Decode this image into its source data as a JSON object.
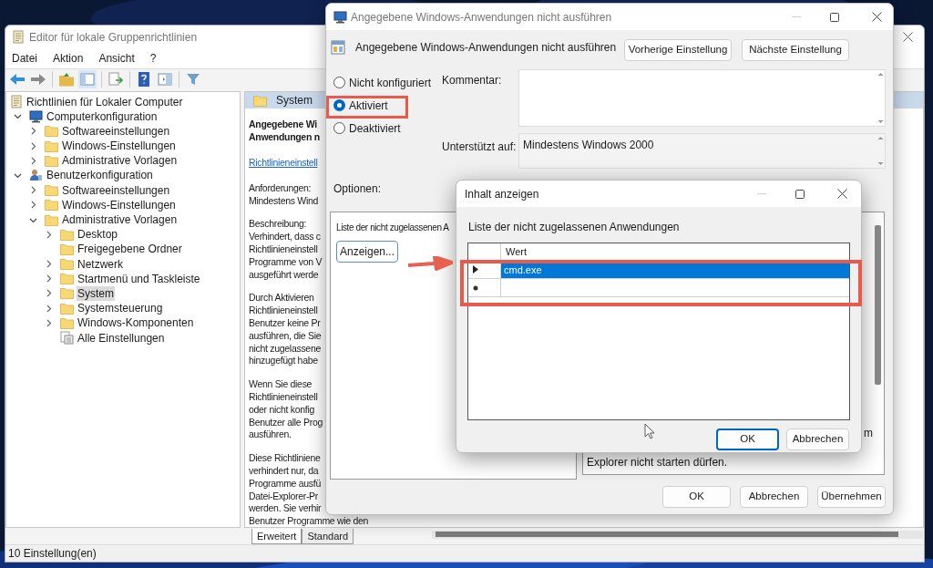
{
  "main_window": {
    "title": "Editor für lokale Gruppenrichtlinien",
    "menu": [
      "Datei",
      "Aktion",
      "Ansicht",
      "?"
    ],
    "tree": {
      "label": "Richtlinien für Lokaler Computer",
      "kind": "policy",
      "selected": false,
      "children": [
        {
          "label": "Computerkonfiguration",
          "kind": "computer",
          "expanded": true,
          "selected": false,
          "children": [
            {
              "label": "Softwareeinstellungen",
              "kind": "folder",
              "expanded": false,
              "selected": false
            },
            {
              "label": "Windows-Einstellungen",
              "kind": "folder",
              "expanded": false,
              "selected": false
            },
            {
              "label": "Administrative Vorlagen",
              "kind": "folder",
              "expanded": false,
              "selected": false
            }
          ]
        },
        {
          "label": "Benutzerkonfiguration",
          "kind": "user",
          "expanded": true,
          "selected": false,
          "children": [
            {
              "label": "Softwareeinstellungen",
              "kind": "folder",
              "expanded": false,
              "selected": false
            },
            {
              "label": "Windows-Einstellungen",
              "kind": "folder",
              "expanded": false,
              "selected": false
            },
            {
              "label": "Administrative Vorlagen",
              "kind": "folder",
              "expanded": true,
              "selected": false,
              "children": [
                {
                  "label": "Desktop",
                  "kind": "folder",
                  "expanded": false,
                  "selected": false
                },
                {
                  "label": "Freigegebene Ordner",
                  "kind": "folder",
                  "selected": false
                },
                {
                  "label": "Netzwerk",
                  "kind": "folder",
                  "expanded": false,
                  "selected": false
                },
                {
                  "label": "Startmenü und Taskleiste",
                  "kind": "folder",
                  "expanded": false,
                  "selected": false
                },
                {
                  "label": "System",
                  "kind": "folder",
                  "expanded": false,
                  "selected": true
                },
                {
                  "label": "Systemsteuerung",
                  "kind": "folder",
                  "expanded": false,
                  "selected": false
                },
                {
                  "label": "Windows-Komponenten",
                  "kind": "folder",
                  "expanded": false,
                  "selected": false
                },
                {
                  "label": "Alle Einstellungen",
                  "kind": "settings",
                  "selected": false
                }
              ]
            }
          ]
        }
      ]
    },
    "details": {
      "header": "System",
      "title_lines": [
        "Angegebene Wi",
        "Anwendungen n"
      ],
      "link": "Richtlinieneinstell",
      "paragraphs": [
        [
          "Anforderungen:",
          "Mindestens Wind"
        ],
        [
          "Beschreibung:",
          "Verhindert, dass c",
          "Richtlinieneinstell",
          "Programme von V",
          "ausgeführt werde"
        ],
        [
          "Durch Aktivieren",
          "Richtlinieneinstell",
          "Benutzer keine Pr",
          "ausführen, die Sie",
          "nicht zugelassene",
          "hinzugefügt habe"
        ],
        [
          "Wenn Sie diese",
          "Richtlinieneinstell",
          "oder nicht konfig",
          "Benutzer alle Prog",
          "ausführen."
        ],
        [
          "Diese Richtlinienе",
          "verhindert nur, da",
          "Programme ausfü",
          "Datei-Explorer-Pr",
          "werden. Sie verhir",
          "Benutzer Programme wie den"
        ]
      ]
    },
    "tabs": [
      {
        "label": "Erweitert",
        "selected": true
      },
      {
        "label": "Standard",
        "selected": false
      }
    ],
    "status_bar": "10 Einstellung(en)"
  },
  "policy_dialog": {
    "title": "Angegebene Windows-Anwendungen nicht ausführen",
    "heading": "Angegebene Windows-Anwendungen nicht ausführen",
    "nav_buttons": [
      "Vorherige Einstellung",
      "Nächste Einstellung"
    ],
    "options": [
      {
        "label": "Nicht konfiguriert",
        "selected": false
      },
      {
        "label": "Aktiviert",
        "selected": true
      },
      {
        "label": "Deaktiviert",
        "selected": false
      }
    ],
    "comment_label": "Kommentar:",
    "supported_label": "Unterstützt auf:",
    "supported_value": "Mindestens Windows 2000",
    "options_label": "Optionen:",
    "options_pane": {
      "list_label": "Liste der nicht zugelassenen A",
      "button": "Anzeigen..."
    },
    "help_pane": {
      "lines": [
        {
          "kind": "fragment",
          "text": "m"
        },
        {
          "kind": "line",
          "text": "Explorer nicht starten dürfen."
        }
      ]
    },
    "buttons": [
      "OK",
      "Abbrechen",
      "Übernehmen"
    ]
  },
  "content_dialog": {
    "title": "Inhalt anzeigen",
    "label": "Liste der nicht zugelassenen Anwendungen",
    "column": "Wert",
    "rows": [
      {
        "kind": "current",
        "value": "cmd.exe",
        "selected": true
      },
      {
        "kind": "new",
        "selected": false
      }
    ],
    "buttons": [
      "OK",
      "Abbrechen"
    ]
  }
}
